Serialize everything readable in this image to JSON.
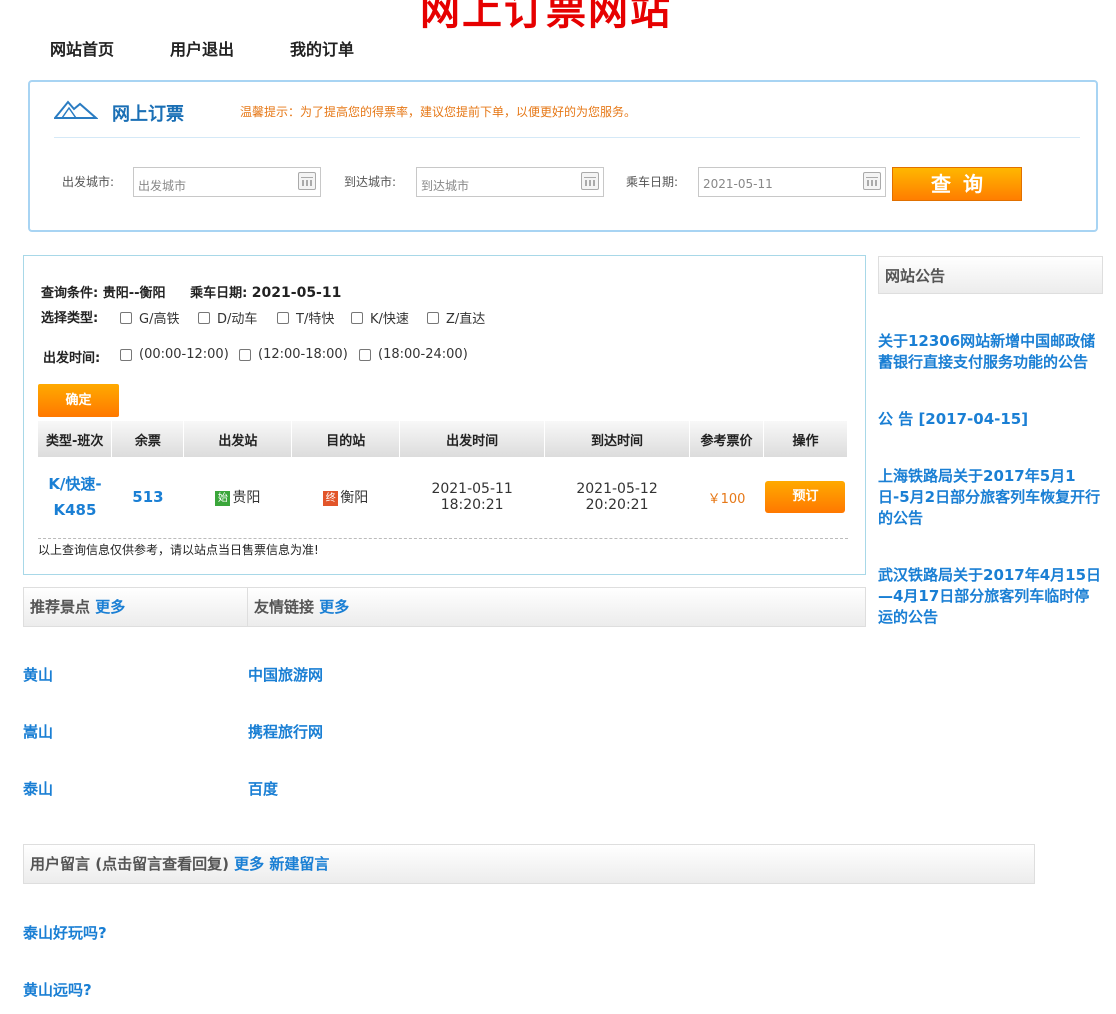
{
  "site": {
    "title": "网上订票网站"
  },
  "nav": {
    "home": "网站首页",
    "logout": "用户退出",
    "orders": "我的订单"
  },
  "booking": {
    "title": "网上订票",
    "tip": "温馨提示：为了提高您的得票率，建议您提前下单，以便更好的为您服务。",
    "from_label": "出发城市:",
    "from_placeholder": "出发城市",
    "to_label": "到达城市:",
    "to_placeholder": "到达城市",
    "date_label": "乘车日期:",
    "date_value": "2021-05-11",
    "query_label": "查询"
  },
  "results": {
    "condition_label": "查询条件:",
    "condition_value": "贵阳--衡阳",
    "date_label": "乘车日期:",
    "date_value": "2021-05-11",
    "type_label": "选择类型:",
    "types": [
      "G/高铁",
      "D/动车",
      "T/特快",
      "K/快速",
      "Z/直达"
    ],
    "time_label": "出发时间:",
    "times": [
      "(00:00-12:00)",
      "(12:00-18:00)",
      "(18:00-24:00)"
    ],
    "confirm_label": "确定",
    "columns": [
      "类型-班次",
      "余票",
      "出发站",
      "目的站",
      "出发时间",
      "到达时间",
      "参考票价",
      "操作"
    ],
    "rows": [
      {
        "train_type": "K/快速-",
        "train_no": "K485",
        "remaining": "513",
        "from_badge": "始",
        "from": "贵阳",
        "to_badge": "终",
        "to": "衡阳",
        "depart": "2021-05-11 18:20:21",
        "arrive": "2021-05-12 20:20:21",
        "price": "￥100",
        "action": "预订"
      }
    ],
    "note": "以上查询信息仅供参考，请以站点当日售票信息为准!"
  },
  "scenic": {
    "title": "推荐景点",
    "more": "更多",
    "items": [
      "黄山",
      "嵩山",
      "泰山"
    ]
  },
  "links": {
    "title": "友情链接",
    "more": "更多",
    "items": [
      "中国旅游网",
      "携程旅行网",
      "百度"
    ]
  },
  "messages": {
    "title": "用户留言 (点击留言查看回复)",
    "more": "更多",
    "new": "新建留言",
    "items": [
      "泰山好玩吗?",
      "黄山远吗?"
    ]
  },
  "notices": {
    "title": "网站公告",
    "items": [
      "关于12306网站新增中国邮政储蓄银行直接支付服务功能的公告",
      "公 告 [2017-04-15]",
      "上海铁路局关于2017年5月1日-5月2日部分旅客列车恢复开行的公告",
      "武汉铁路局关于2017年4月15日—4月17日部分旅客列车临时停运的公告"
    ]
  },
  "colors": {
    "brand_red": "#e60000",
    "link_blue": "#1a7fd4",
    "accent_orange": "#ff8a00"
  }
}
